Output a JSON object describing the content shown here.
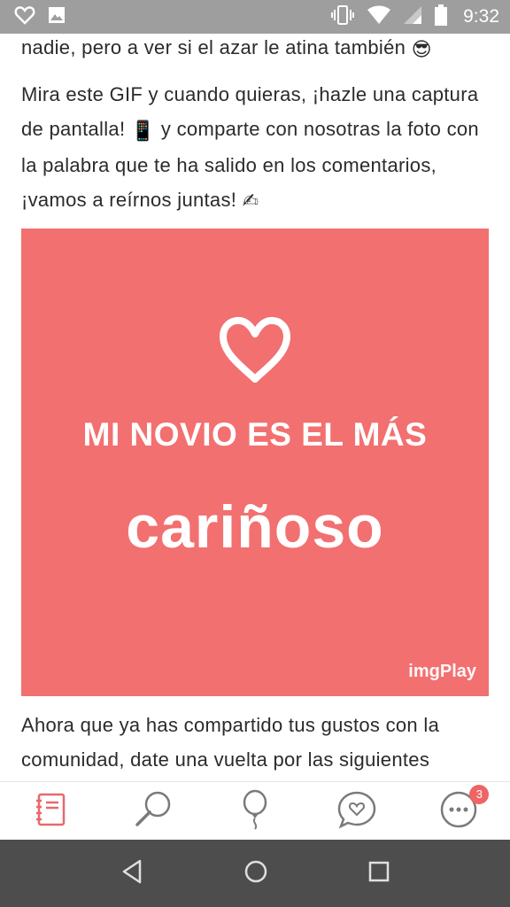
{
  "status_bar": {
    "time": "9:32",
    "icons": [
      "heart-outline-icon",
      "image-icon",
      "vibrate-icon",
      "wifi-icon",
      "signal-icon",
      "battery-icon"
    ]
  },
  "article": {
    "line_top": "nadie, pero a ver si el azar le atina también",
    "paragraph_intro_a": "Mira este GIF y cuando quieras, ¡hazle una captura de pantalla!",
    "paragraph_intro_b": "y comparte con nosotras la foto con la palabra que te ha salido en los comentarios, ¡vamos a reírnos juntas!",
    "emojis": {
      "sunglasses": "😎",
      "phone": "📱",
      "writing_hand": "✍"
    },
    "paragraph_next": "Ahora que ya has compartido tus gustos con la comunidad, date una vuelta por las siguientes"
  },
  "gif": {
    "line1": "MI NOVIO ES EL MÁS",
    "line2": "cariñoso",
    "brand": "imgPlay",
    "background": "#f27070"
  },
  "bottom_nav": {
    "items": [
      "notebook-icon",
      "search-icon",
      "balloon-icon",
      "chat-heart-icon",
      "more-icon"
    ],
    "active_color": "#e8686b",
    "badge_count": "3"
  }
}
